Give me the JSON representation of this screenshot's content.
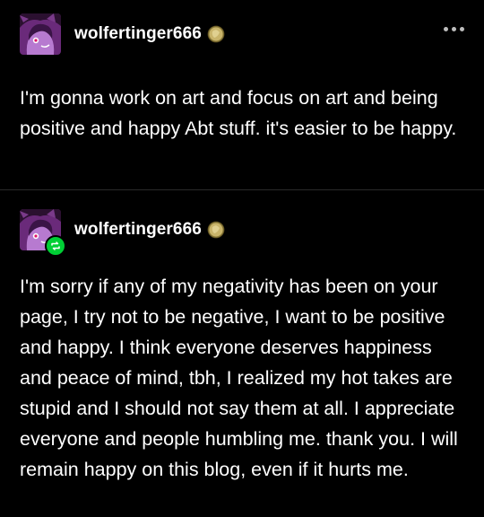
{
  "posts": [
    {
      "username": "wolfertinger666",
      "avatar_icon": "avatar-icon",
      "badge_icon": "coin-badge-icon",
      "more_icon": "more-options-icon",
      "body": "I'm gonna work on art and focus on art and being positive and happy Abt stuff. it's easier to be happy."
    },
    {
      "username": "wolfertinger666",
      "avatar_icon": "avatar-icon",
      "reblog_icon": "reblog-icon",
      "badge_icon": "coin-badge-icon",
      "body": "I'm sorry if any of my negativity has been on your page, I try not to be negative, I want to be positive and happy. I think everyone deserves happiness and peace of mind, tbh, I realized my hot takes are stupid and I should not say them at all. I appreciate everyone and people humbling me. thank you. I will remain happy on this blog, even if it hurts me."
    }
  ],
  "colors": {
    "background": "#000000",
    "text": "#ffffff",
    "divider": "#2a2a2a",
    "reblog_green": "#00cf35",
    "coin_gold": "#c9b46a"
  }
}
